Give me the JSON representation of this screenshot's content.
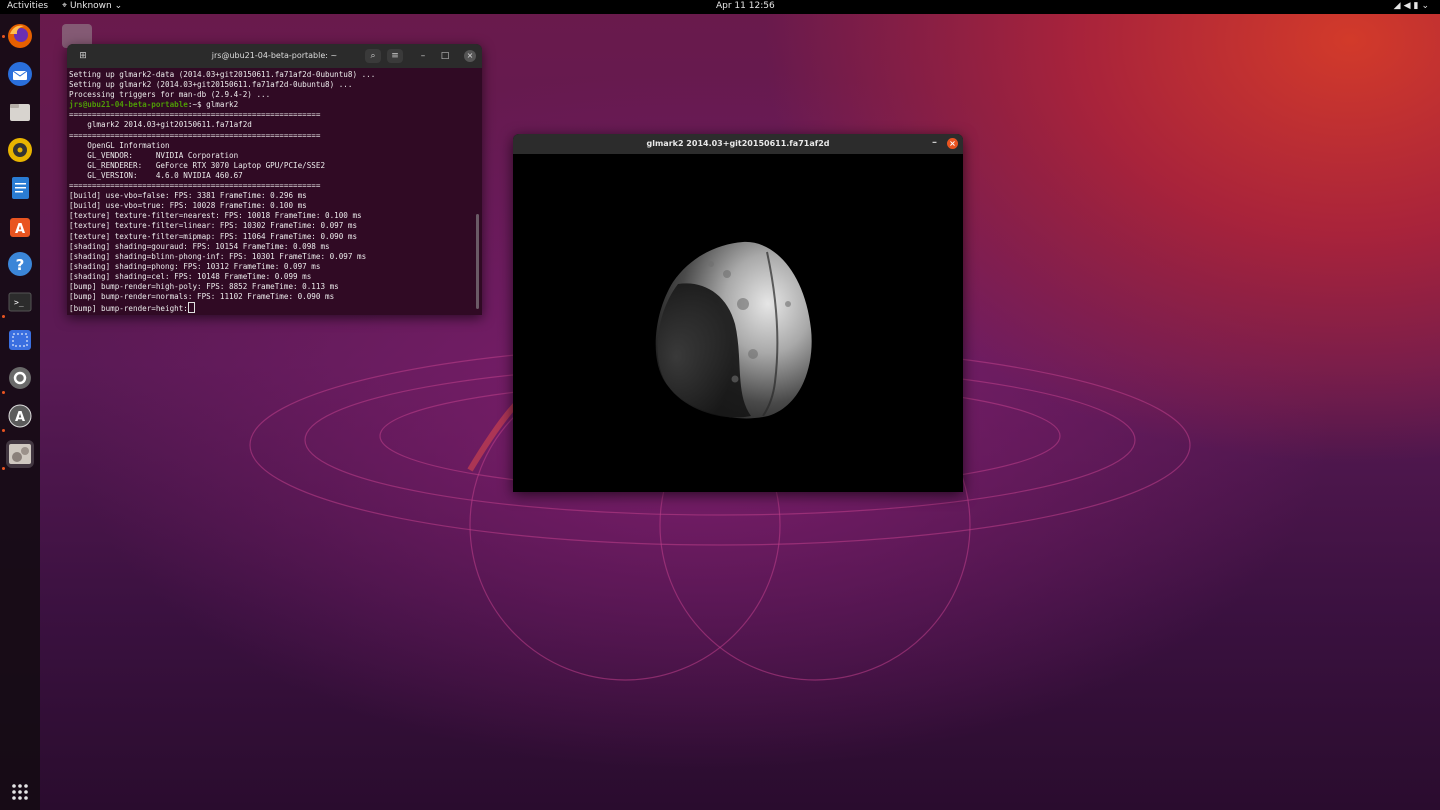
{
  "topbar": {
    "activities": "Activities",
    "app_menu": "Unknown",
    "clock": "Apr 11  12:56",
    "tray_icons": [
      "wifi-icon",
      "volume-icon",
      "battery-icon",
      "power-menu-icon"
    ]
  },
  "dock": {
    "items": [
      {
        "name": "Firefox",
        "icon": "firefox-icon",
        "color": "#e66000"
      },
      {
        "name": "Thunderbird",
        "icon": "thunderbird-icon",
        "color": "#2a6fdb"
      },
      {
        "name": "Files",
        "icon": "files-icon",
        "color": "#d8d4cf"
      },
      {
        "name": "Rhythmbox",
        "icon": "rhythmbox-icon",
        "color": "#e8b400"
      },
      {
        "name": "LibreOffice Writer",
        "icon": "writer-icon",
        "color": "#2a7cd3"
      },
      {
        "name": "Ubuntu Software",
        "icon": "software-icon",
        "color": "#e95420"
      },
      {
        "name": "Help",
        "icon": "help-icon",
        "color": "#3b86d8"
      },
      {
        "name": "Terminal",
        "icon": "terminal-icon",
        "color": "#2c2c2c"
      },
      {
        "name": "Screenshot",
        "icon": "screenshot-icon",
        "color": "#3a6fe0"
      },
      {
        "name": "Settings",
        "icon": "settings-icon",
        "color": "#6a6a6a"
      },
      {
        "name": "Software Updater",
        "icon": "updater-icon",
        "color": "#5b5b5b"
      },
      {
        "name": "glmark2",
        "icon": "glmark2-icon",
        "color": "#b9b1aa"
      }
    ],
    "show_apps_icon": "app-grid-icon"
  },
  "terminal": {
    "title": "jrs@ubu21-04-beta-portable: ~",
    "lines": [
      "Setting up glmark2-data (2014.03+git20150611.fa71af2d-0ubuntu8) ...",
      "Setting up glmark2 (2014.03+git20150611.fa71af2d-0ubuntu8) ...",
      "Processing triggers for man-db (2.9.4-2) ..."
    ],
    "prompt_user": "jrs@ubu21-04-beta-portable",
    "prompt_rest": ":~$ glmark2",
    "output": [
      "=======================================================",
      "    glmark2 2014.03+git20150611.fa71af2d",
      "=======================================================",
      "    OpenGL Information",
      "    GL_VENDOR:     NVIDIA Corporation",
      "    GL_RENDERER:   GeForce RTX 3070 Laptop GPU/PCIe/SSE2",
      "    GL_VERSION:    4.6.0 NVIDIA 460.67",
      "=======================================================",
      "[build] use-vbo=false: FPS: 3381 FrameTime: 0.296 ms",
      "[build] use-vbo=true: FPS: 10028 FrameTime: 0.100 ms",
      "[texture] texture-filter=nearest: FPS: 10018 FrameTime: 0.100 ms",
      "[texture] texture-filter=linear: FPS: 10302 FrameTime: 0.097 ms",
      "[texture] texture-filter=mipmap: FPS: 11064 FrameTime: 0.090 ms",
      "[shading] shading=gouraud: FPS: 10154 FrameTime: 0.098 ms",
      "[shading] shading=blinn-phong-inf: FPS: 10301 FrameTime: 0.097 ms",
      "[shading] shading=phong: FPS: 10312 FrameTime: 0.097 ms",
      "[shading] shading=cel: FPS: 10148 FrameTime: 0.099 ms",
      "[bump] bump-render=high-poly: FPS: 8852 FrameTime: 0.113 ms",
      "[bump] bump-render=normals: FPS: 11102 FrameTime: 0.090 ms"
    ],
    "current_line": "[bump] bump-render=height:"
  },
  "glmark2_window": {
    "title": "glmark2 2014.03+git20150611.fa71af2d"
  }
}
